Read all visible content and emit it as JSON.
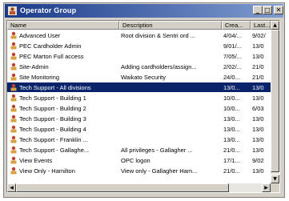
{
  "window": {
    "title": "Operator Group"
  },
  "titlebar_buttons": {
    "minimize": "_",
    "maximize": "□",
    "close": "✕"
  },
  "columns": [
    "Name",
    "Description",
    "Crea...",
    "Last..."
  ],
  "rows": [
    {
      "name": "Advanced User",
      "description": "Root division & Sentri ord ...",
      "created": "4/04/...",
      "last": "9/02/"
    },
    {
      "name": "PEC Cardholder Admin",
      "description": "",
      "created": "9/01/...",
      "last": "13/0"
    },
    {
      "name": "PEC Marton Full access",
      "description": "",
      "created": "7/05/...",
      "last": "13/0"
    },
    {
      "name": "Site-Admin",
      "description": "Adding cardholders/assign...",
      "created": "2/02/...",
      "last": "21/0"
    },
    {
      "name": "Site Monitoring",
      "description": "Waikato Security",
      "created": "24/0...",
      "last": "21/0"
    },
    {
      "name": "Tech Support - All divisions",
      "description": "",
      "created": "13/0...",
      "last": "13/0",
      "selected": true
    },
    {
      "name": "Tech Support - Building 1",
      "description": "",
      "created": "10/0...",
      "last": "13/0"
    },
    {
      "name": "Tech Support - Building 2",
      "description": "",
      "created": "10/0...",
      "last": "6/03"
    },
    {
      "name": "Tech Support - Building 3",
      "description": "",
      "created": "13/0...",
      "last": "13/0"
    },
    {
      "name": "Tech Support - Building 4",
      "description": "",
      "created": "13/0...",
      "last": "13/0"
    },
    {
      "name": "Tech Support - Franklin ...",
      "description": "",
      "created": "13/0...",
      "last": "13/0"
    },
    {
      "name": "Tech Support - Gallaghe...",
      "description": "All privileges - Gallagher ...",
      "created": "21/0...",
      "last": "13/0"
    },
    {
      "name": "View Events",
      "description": "OPC logon",
      "created": "17/1...",
      "last": "9/02"
    },
    {
      "name": "View Only - Hamilton",
      "description": "View only - Gallagher Ham...",
      "created": "21/0...",
      "last": "13/0"
    }
  ],
  "scroll_arrows": {
    "up": "▲",
    "down": "▼",
    "left": "◀",
    "right": "▶"
  },
  "colors": {
    "titlebar_start": "#1a3a8a",
    "titlebar_end": "#7f9ccf",
    "selection": "#0a246a",
    "face": "#d4d0c8",
    "icon_body": "#c0402a"
  }
}
